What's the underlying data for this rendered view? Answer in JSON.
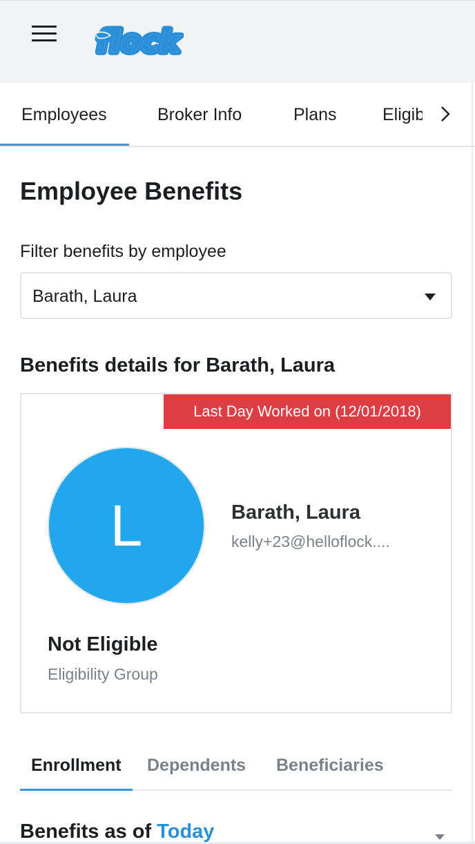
{
  "header": {
    "menu_icon": "hamburger-menu-icon",
    "logo_text": "flock",
    "brand_color": "#2a8fd6"
  },
  "nav_tabs": [
    {
      "label": "Employees",
      "active": true
    },
    {
      "label": "Broker Info",
      "active": false
    },
    {
      "label": "Plans",
      "active": false
    },
    {
      "label": "Eligibility",
      "active": false
    }
  ],
  "nav_more_icon": "chevron-right-icon",
  "page": {
    "title": "Employee Benefits",
    "filter_label": "Filter benefits by employee",
    "filter_selected": "Barath, Laura",
    "details_title": "Benefits details for Barath, Laura"
  },
  "employee_card": {
    "status_ribbon": "Last Day Worked on (12/01/2018)",
    "ribbon_color": "#dd3e44",
    "avatar_initial": "L",
    "avatar_color": "#22a7ed",
    "name": "Barath, Laura",
    "email": "kelly+23@helloflock....",
    "eligibility_status": "Not Eligible",
    "eligibility_label": "Eligibility Group"
  },
  "sub_tabs": [
    {
      "label": "Enrollment",
      "active": true
    },
    {
      "label": "Dependents",
      "active": false
    },
    {
      "label": "Beneficiaries",
      "active": false
    }
  ],
  "benefits_as_of": {
    "label": "Benefits as of",
    "value": "Today"
  }
}
